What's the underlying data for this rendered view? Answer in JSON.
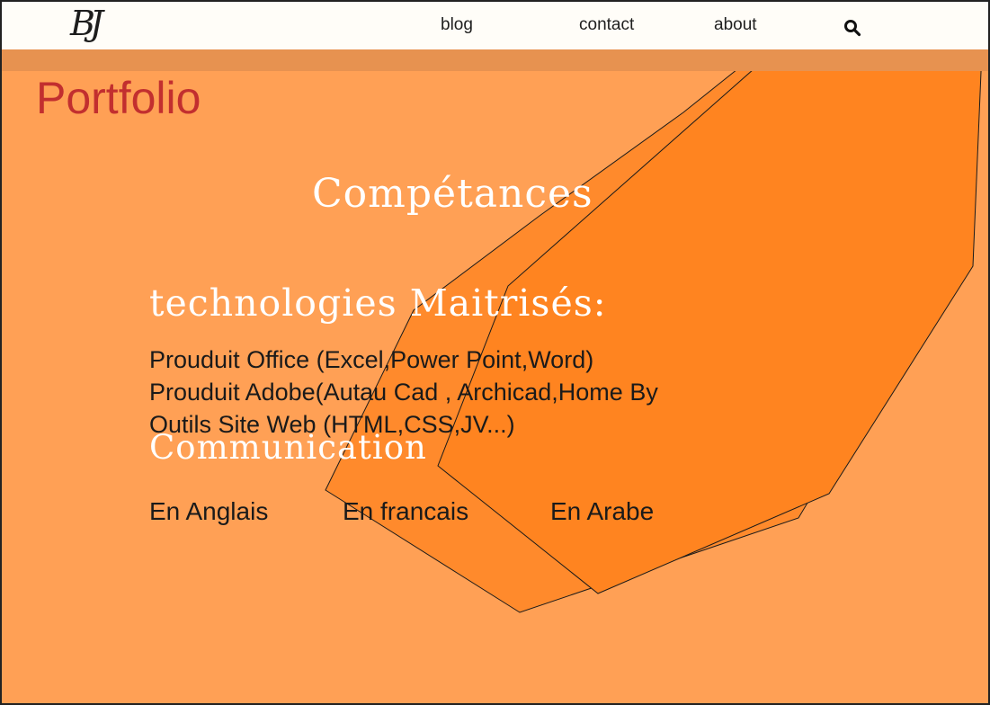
{
  "header": {
    "logo": "BJ",
    "nav": {
      "blog": "blog",
      "contact": "contact",
      "about": "about"
    },
    "search_icon": "search-icon"
  },
  "main": {
    "title": "Portfolio",
    "competences_heading": "Compétances",
    "technologies": {
      "heading": "technologies Maitrisés:",
      "items": [
        "Prouduit Office (Excel,Power Point,Word)",
        "Prouduit Adobe(Autau Cad , Archicad,Home By",
        "Outils Site Web (HTML,CSS,JV...)"
      ]
    },
    "communication": {
      "heading": "Communication",
      "languages": [
        "En Anglais",
        "En francais",
        "En Arabe"
      ]
    }
  },
  "colors": {
    "background": "#ffa055",
    "header": "#fffdf8",
    "title": "#c22f2f",
    "accent_shape": "#ff8520"
  }
}
